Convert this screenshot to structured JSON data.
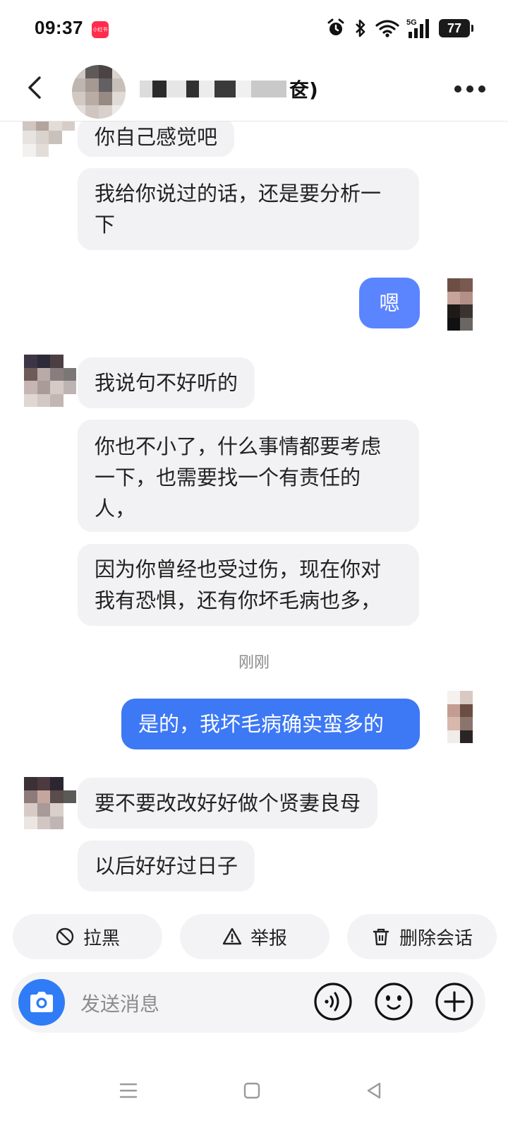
{
  "status_bar": {
    "time": "09:37",
    "app_badge": "小红书",
    "network": "5G",
    "battery": "77"
  },
  "header": {
    "title_suffix": "奁)",
    "icons": [
      "back-arrow-icon",
      "more-dots-icon"
    ]
  },
  "messages": [
    {
      "from": "them",
      "text": "你自己感觉吧"
    },
    {
      "from": "them",
      "text": "我给你说过的话，还是要分析一\n下"
    },
    {
      "from": "me",
      "text": "嗯"
    },
    {
      "from": "them",
      "text": "我说句不好听的"
    },
    {
      "from": "them",
      "text": "你也不小了，什么事情都要考虑\n一下，也需要找一个有责任的\n人，"
    },
    {
      "from": "them",
      "text": "因为你曾经也受过伤，现在你对\n我有恐惧，还有你坏毛病也多，"
    },
    {
      "from": "me",
      "text": "是的，我坏毛病确实蛮多的"
    },
    {
      "from": "them",
      "text": "要不要改改好好做个贤妻良母"
    },
    {
      "from": "them",
      "text": "以后好好过日子"
    }
  ],
  "timestamp": "刚刚",
  "quick_actions": [
    {
      "label": "拉黑",
      "icon": "block-icon"
    },
    {
      "label": "举报",
      "icon": "warning-icon"
    },
    {
      "label": "删除会话",
      "icon": "trash-icon"
    }
  ],
  "composer": {
    "placeholder": "发送消息",
    "icons": [
      "camera-icon",
      "voice-icon",
      "emoji-icon",
      "plus-icon"
    ]
  },
  "colors": {
    "accent_blue": "#3d78f5",
    "bubble_gray": "#f2f2f4",
    "camera_blue": "#2f7cf6"
  }
}
